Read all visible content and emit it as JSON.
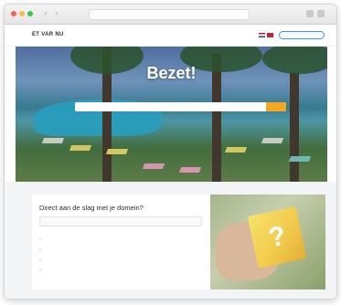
{
  "browser": {
    "url": "",
    "nav_back": "‹",
    "nav_forward": "›"
  },
  "site": {
    "logo": "ET VAR NU",
    "login_button": "",
    "accent_color": "#4a90d9",
    "cta_color": "#f5a623"
  },
  "hero": {
    "title": "Bezet!",
    "subtitle": "",
    "search_placeholder": "",
    "search_button": ""
  },
  "help": {
    "title": "Direct aan de slag met je domein?",
    "input_placeholder": "",
    "questions": [
      "",
      "",
      "",
      ""
    ]
  },
  "icons": [
    "back-arrow-icon",
    "forward-arrow-icon",
    "flag-nl-icon",
    "flag-uk-icon",
    "chevron-right-icon"
  ]
}
